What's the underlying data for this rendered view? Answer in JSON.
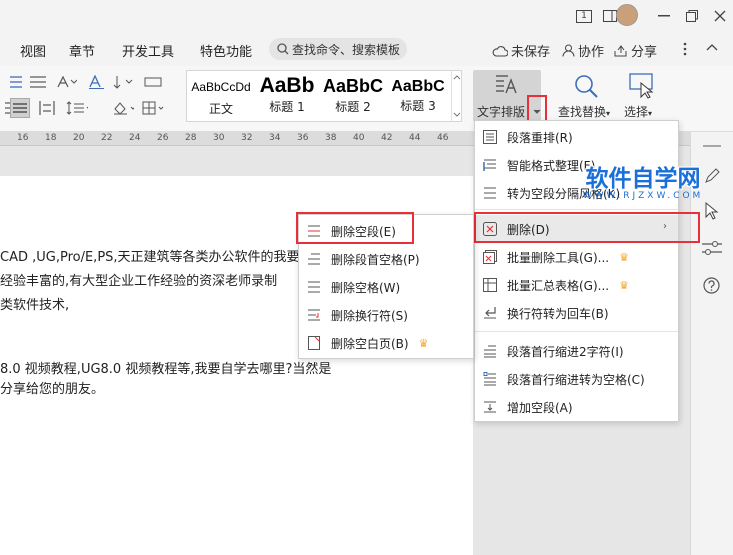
{
  "titlebar": {
    "window_count": "1"
  },
  "menu": {
    "items": [
      "视图",
      "章节",
      "开发工具",
      "特色功能"
    ],
    "search_placeholder": "查找命令、搜索模板",
    "unsaved": "未保存",
    "collab": "协作",
    "share": "分享"
  },
  "ribbon": {
    "styles": [
      {
        "sample": "AaBbCcDd",
        "name": "正文"
      },
      {
        "sample": "AaBb",
        "name": "标题 1"
      },
      {
        "sample": "AaBbC",
        "name": "标题 2"
      },
      {
        "sample": "AaBbC",
        "name": "标题 3"
      }
    ],
    "text_layout": "文字排版",
    "find_replace": "查找替换",
    "select": "选择"
  },
  "ruler": {
    "ticks": [
      "16",
      "18",
      "20",
      "22",
      "24",
      "26",
      "28",
      "30",
      "32",
      "34",
      "36",
      "38",
      "40",
      "42",
      "44",
      "46"
    ]
  },
  "document": {
    "lines": [
      "CAD ,UG,Pro/E,PS,天正建筑等各类办公软件的我要",
      "经验丰富的,有大型企业工作经验的资深老师录制",
      "类软件技术,",
      "",
      "8.0 视频教程,UG8.0 视频教程等,我要自学去哪里?当然是",
      "分享给您的朋友。"
    ]
  },
  "dropdown": {
    "items": [
      {
        "label": "段落重排(R)",
        "icon": "paragraph-rearrange-icon"
      },
      {
        "label": "智能格式整理(F)",
        "icon": "smart-format-icon"
      },
      {
        "label": "转为空段分隔风格(K)",
        "icon": "empty-paragraph-style-icon"
      },
      {
        "label": "删除(D)",
        "icon": "delete-icon"
      },
      {
        "label": "批量删除工具(G)...",
        "icon": "batch-delete-icon"
      },
      {
        "label": "批量汇总表格(G)...",
        "icon": "batch-table-icon"
      },
      {
        "label": "换行符转为回车(B)",
        "icon": "line-break-icon"
      },
      {
        "label": "段落首行缩进2字符(I)",
        "icon": "indent-icon"
      },
      {
        "label": "段落首行缩进转为空格(C)",
        "icon": "indent-space-icon"
      },
      {
        "label": "增加空段(A)",
        "icon": "add-paragraph-icon"
      }
    ]
  },
  "submenu": {
    "items": [
      {
        "label": "删除空段(E)"
      },
      {
        "label": "删除段首空格(P)"
      },
      {
        "label": "删除空格(W)"
      },
      {
        "label": "删除换行符(S)"
      },
      {
        "label": "删除空白页(B)"
      }
    ]
  },
  "watermark": {
    "title": "软件自学网",
    "url": "WWW.RJZXW.COM"
  },
  "colors": {
    "highlight_red": "#e8303a",
    "accent_blue": "#1a6fd8",
    "crown_gold": "#f5a623"
  }
}
